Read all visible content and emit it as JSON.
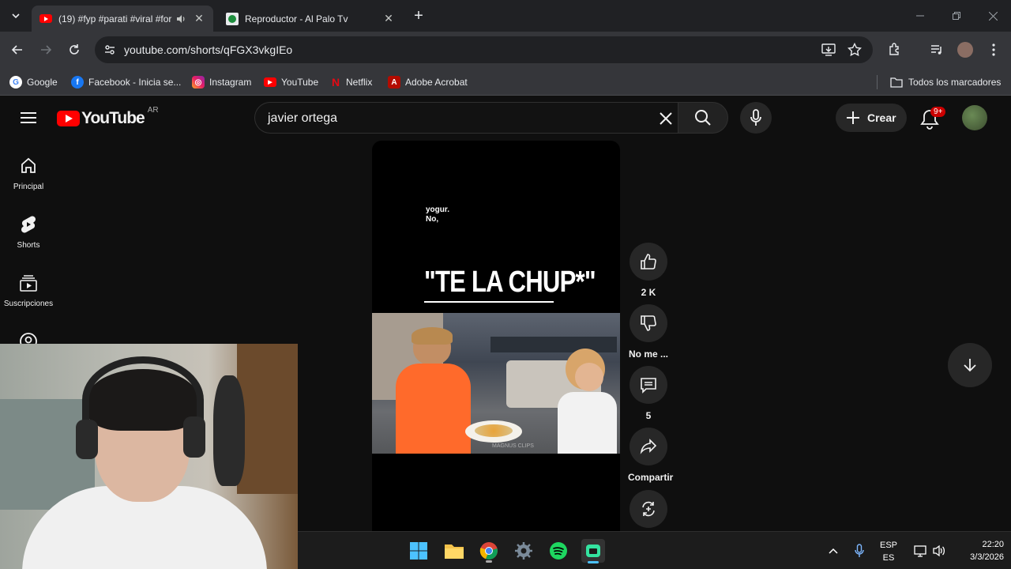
{
  "browser": {
    "tabs": [
      {
        "title": "(19) #fyp #parati #viral #for",
        "icon": "youtube-favicon",
        "audio": true
      },
      {
        "title": "Reproductor - Al Palo Tv",
        "icon": "player-favicon"
      }
    ],
    "url": "youtube.com/shorts/qFGX3vkgIEo",
    "bookmarks": [
      {
        "label": "Google",
        "icon": "google-icon"
      },
      {
        "label": "Facebook - Inicia se...",
        "icon": "facebook-icon"
      },
      {
        "label": "Instagram",
        "icon": "instagram-icon"
      },
      {
        "label": "YouTube",
        "icon": "youtube-icon"
      },
      {
        "label": "Netflix",
        "icon": "netflix-icon"
      },
      {
        "label": "Adobe Acrobat",
        "icon": "acrobat-icon"
      }
    ],
    "all_bookmarks": "Todos los marcadores"
  },
  "youtube": {
    "logo_text": "YouTube",
    "region": "AR",
    "search_query": "javier ortega",
    "create_label": "Crear",
    "notifications_badge": "9+",
    "nav": [
      {
        "label": "Principal",
        "icon": "home-icon"
      },
      {
        "label": "Shorts",
        "icon": "shorts-icon"
      },
      {
        "label": "Suscripciones",
        "icon": "subscriptions-icon"
      }
    ]
  },
  "short": {
    "caption_line1": "yogur.",
    "caption_line2": "No,",
    "headline": "\"TE LA CHUP*\"",
    "watermark": "MAGNUS CLIPS",
    "actions": {
      "likes": "2 K",
      "dislike_label": "No me ...",
      "comments": "5",
      "share_label": "Compartir"
    }
  },
  "taskbar": {
    "lang_top": "ESP",
    "lang_bottom": "ES",
    "time": "22:20",
    "date": "3/3/2026"
  },
  "colors": {
    "yt_red": "#ff0000",
    "chrome_dark": "#202124",
    "chrome_toolbar": "#35363a",
    "yt_bg": "#0f0f0f"
  }
}
